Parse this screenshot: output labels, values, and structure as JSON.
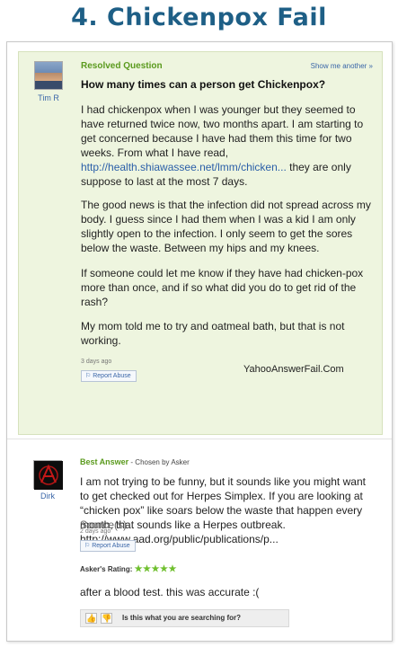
{
  "page": {
    "title": "4. Chickenpox Fail"
  },
  "question": {
    "user": "Tim R",
    "status_label": "Resolved Question",
    "show_more": "Show me another »",
    "title": "How many times can a person get Chickenpox?",
    "body_p1_before_link": "I had chickenpox when I was younger but they seemed to have returned twice now, two months apart. I am starting to get concerned because I have had them this time for two weeks. From what I have read, ",
    "body_p1_link": "http://health.shiawassee.net/lmm/chicken...",
    "body_p1_after_link": " they are only suppose to last at the most 7 days.",
    "body_p2": "The good news is that the infection did not spread across my body. I guess since I had them when I was a kid I am only slightly open to the infection. I only seem to get the sores below the waste. Between my hips and my knees.",
    "body_p3": "If someone could let me know if they have had chicken-pox more than once, and if so what did you do to get rid of the rash?",
    "body_p4": "My mom told me to try and oatmeal bath, but that is not working.",
    "time_ago": "3 days ago",
    "report_abuse": "Report Abuse",
    "watermark": "YahooAnswerFail.Com"
  },
  "answer": {
    "user": "Dirk",
    "best_answer_label": "Best Answer",
    "chosen_by": " - Chosen by Asker",
    "body": "I am not trying to be funny, but it sounds like you might want to get checked out for Herpes Simplex.  If you are looking at “chicken pox” like soars below the waste that happen every month, that sounds like a Herpes outbreak.",
    "source_label": "Source(s):",
    "source_url": "http://www.aad.org/public/publications/p...",
    "time_ago": "2 days ago",
    "report_abuse": "Report Abuse",
    "rating_label": "Asker's Rating: ",
    "rating_stars": "★★★★★",
    "rating_value": 5,
    "rating_comment": "after a blood test. this was accurate :(",
    "feedback_prompt": "Is this what you are searching for?"
  },
  "colors": {
    "title_blue": "#1e5f86",
    "resolved_green": "#5a9a1d",
    "question_bg": "#eef5df",
    "link_blue": "#2b5fa8",
    "star_green": "#6fbf2e"
  },
  "icons": {
    "report_flag": "flag-icon",
    "thumb_up": "thumbs-up-icon",
    "thumb_down": "thumbs-down-icon"
  }
}
